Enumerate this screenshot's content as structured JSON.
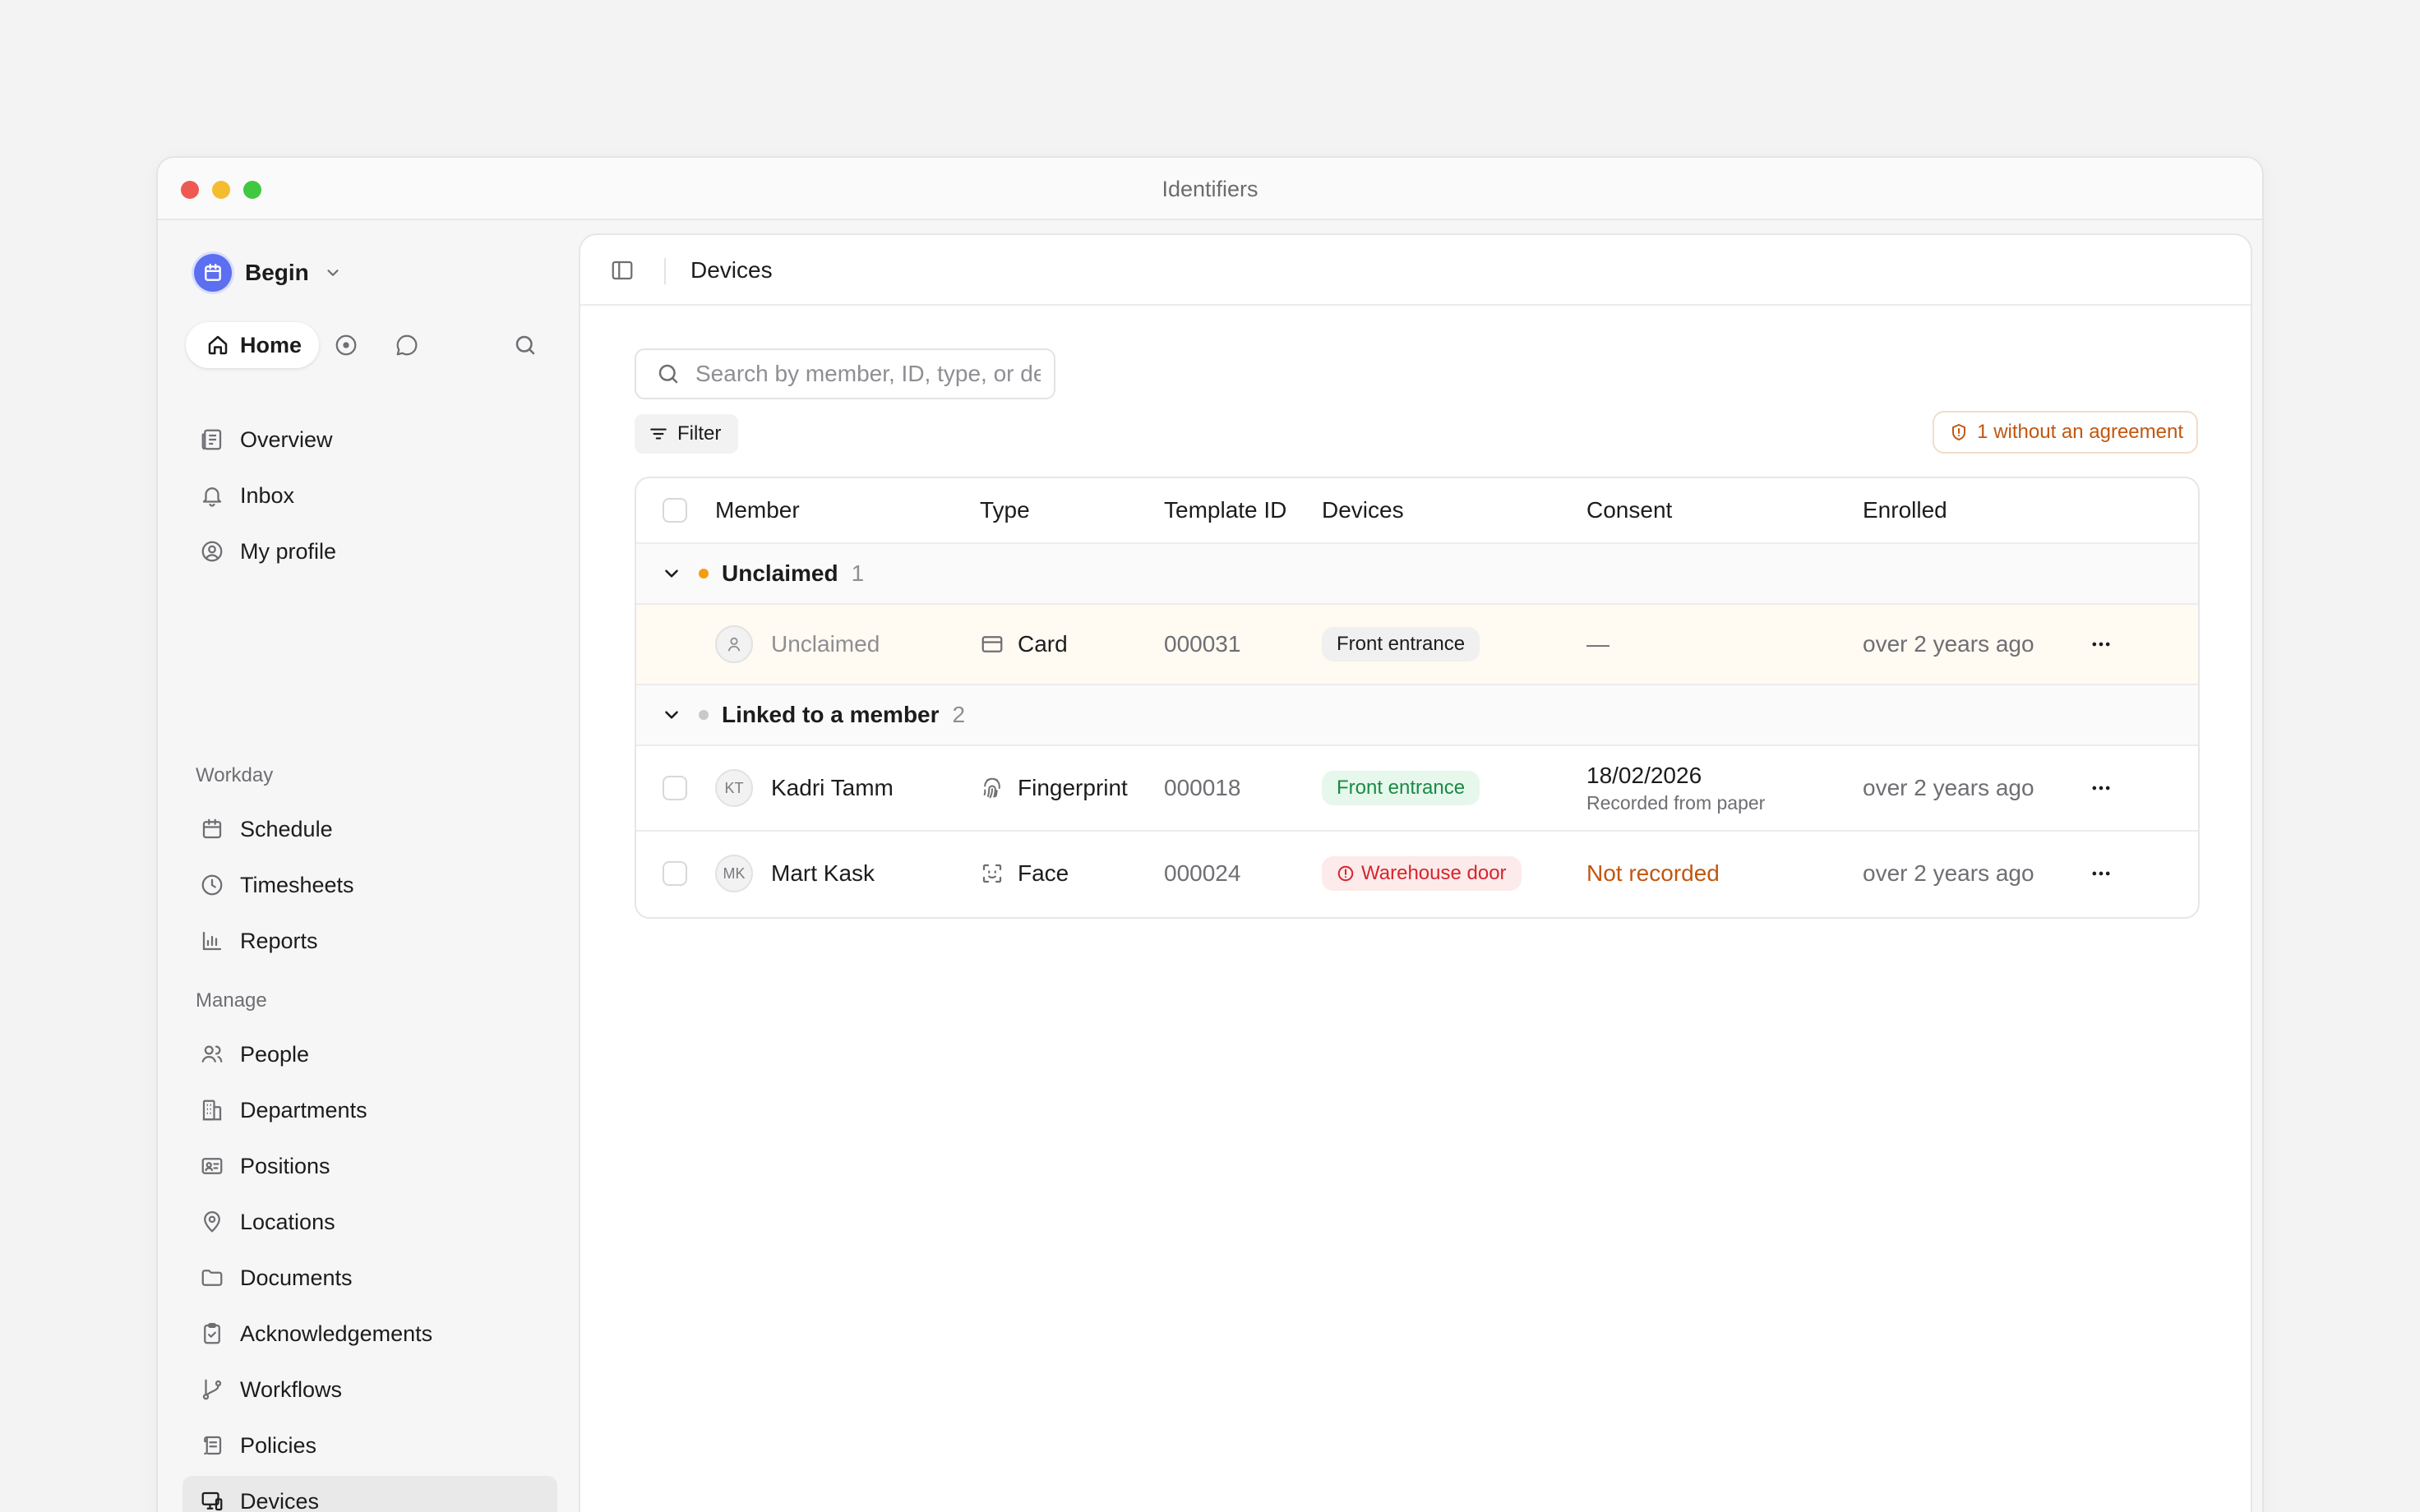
{
  "window": {
    "title": "Identifiers"
  },
  "workspace": {
    "name": "Begin"
  },
  "quickbar": {
    "home_label": "Home"
  },
  "sidebar": {
    "top_items": [
      {
        "label": "Overview",
        "icon": "newspaper-icon"
      },
      {
        "label": "Inbox",
        "icon": "bell-icon"
      },
      {
        "label": "My profile",
        "icon": "user-circle-icon"
      }
    ],
    "sections": [
      {
        "title": "Workday",
        "items": [
          {
            "label": "Schedule",
            "icon": "calendar-icon"
          },
          {
            "label": "Timesheets",
            "icon": "clock-icon"
          },
          {
            "label": "Reports",
            "icon": "bar-chart-icon"
          }
        ]
      },
      {
        "title": "Manage",
        "items": [
          {
            "label": "People",
            "icon": "users-icon"
          },
          {
            "label": "Departments",
            "icon": "building-icon"
          },
          {
            "label": "Positions",
            "icon": "id-card-icon"
          },
          {
            "label": "Locations",
            "icon": "map-pin-icon"
          },
          {
            "label": "Documents",
            "icon": "folder-icon"
          },
          {
            "label": "Acknowledgements",
            "icon": "clipboard-check-icon"
          },
          {
            "label": "Workflows",
            "icon": "git-branch-icon"
          },
          {
            "label": "Policies",
            "icon": "scroll-icon"
          },
          {
            "label": "Devices",
            "icon": "devices-icon",
            "active": true
          }
        ]
      }
    ]
  },
  "header": {
    "title": "Devices"
  },
  "search": {
    "placeholder": "Search by member, ID, type, or device",
    "value": ""
  },
  "toolbar": {
    "filter_label": "Filter",
    "warning_label": "1 without an agreement",
    "warning_color": "#c2560f"
  },
  "table": {
    "columns": [
      "Member",
      "Type",
      "Template ID",
      "Devices",
      "Consent",
      "Enrolled"
    ],
    "groups": [
      {
        "title": "Unclaimed",
        "count": "1",
        "dot_color": "#f59e0b",
        "rows": [
          {
            "initials": "",
            "member": "Unclaimed",
            "type": "Card",
            "type_icon": "credit-card-icon",
            "template_id": "000031",
            "device": "Front entrance",
            "device_status": "neutral",
            "consent": "—",
            "consent_sub": "",
            "enrolled": "over 2 years ago"
          }
        ]
      },
      {
        "title": "Linked to a member",
        "count": "2",
        "dot_color": "#c7c7cc",
        "rows": [
          {
            "initials": "KT",
            "member": "Kadri Tamm",
            "type": "Fingerprint",
            "type_icon": "fingerprint-icon",
            "template_id": "000018",
            "device": "Front entrance",
            "device_status": "ok",
            "consent": "18/02/2026",
            "consent_sub": "Recorded from paper",
            "enrolled": "over 2 years ago"
          },
          {
            "initials": "MK",
            "member": "Mart Kask",
            "type": "Face",
            "type_icon": "face-scan-icon",
            "template_id": "000024",
            "device": "Warehouse door",
            "device_status": "error",
            "consent": "Not recorded",
            "consent_sub": "",
            "enrolled": "over 2 years ago"
          }
        ]
      }
    ]
  }
}
